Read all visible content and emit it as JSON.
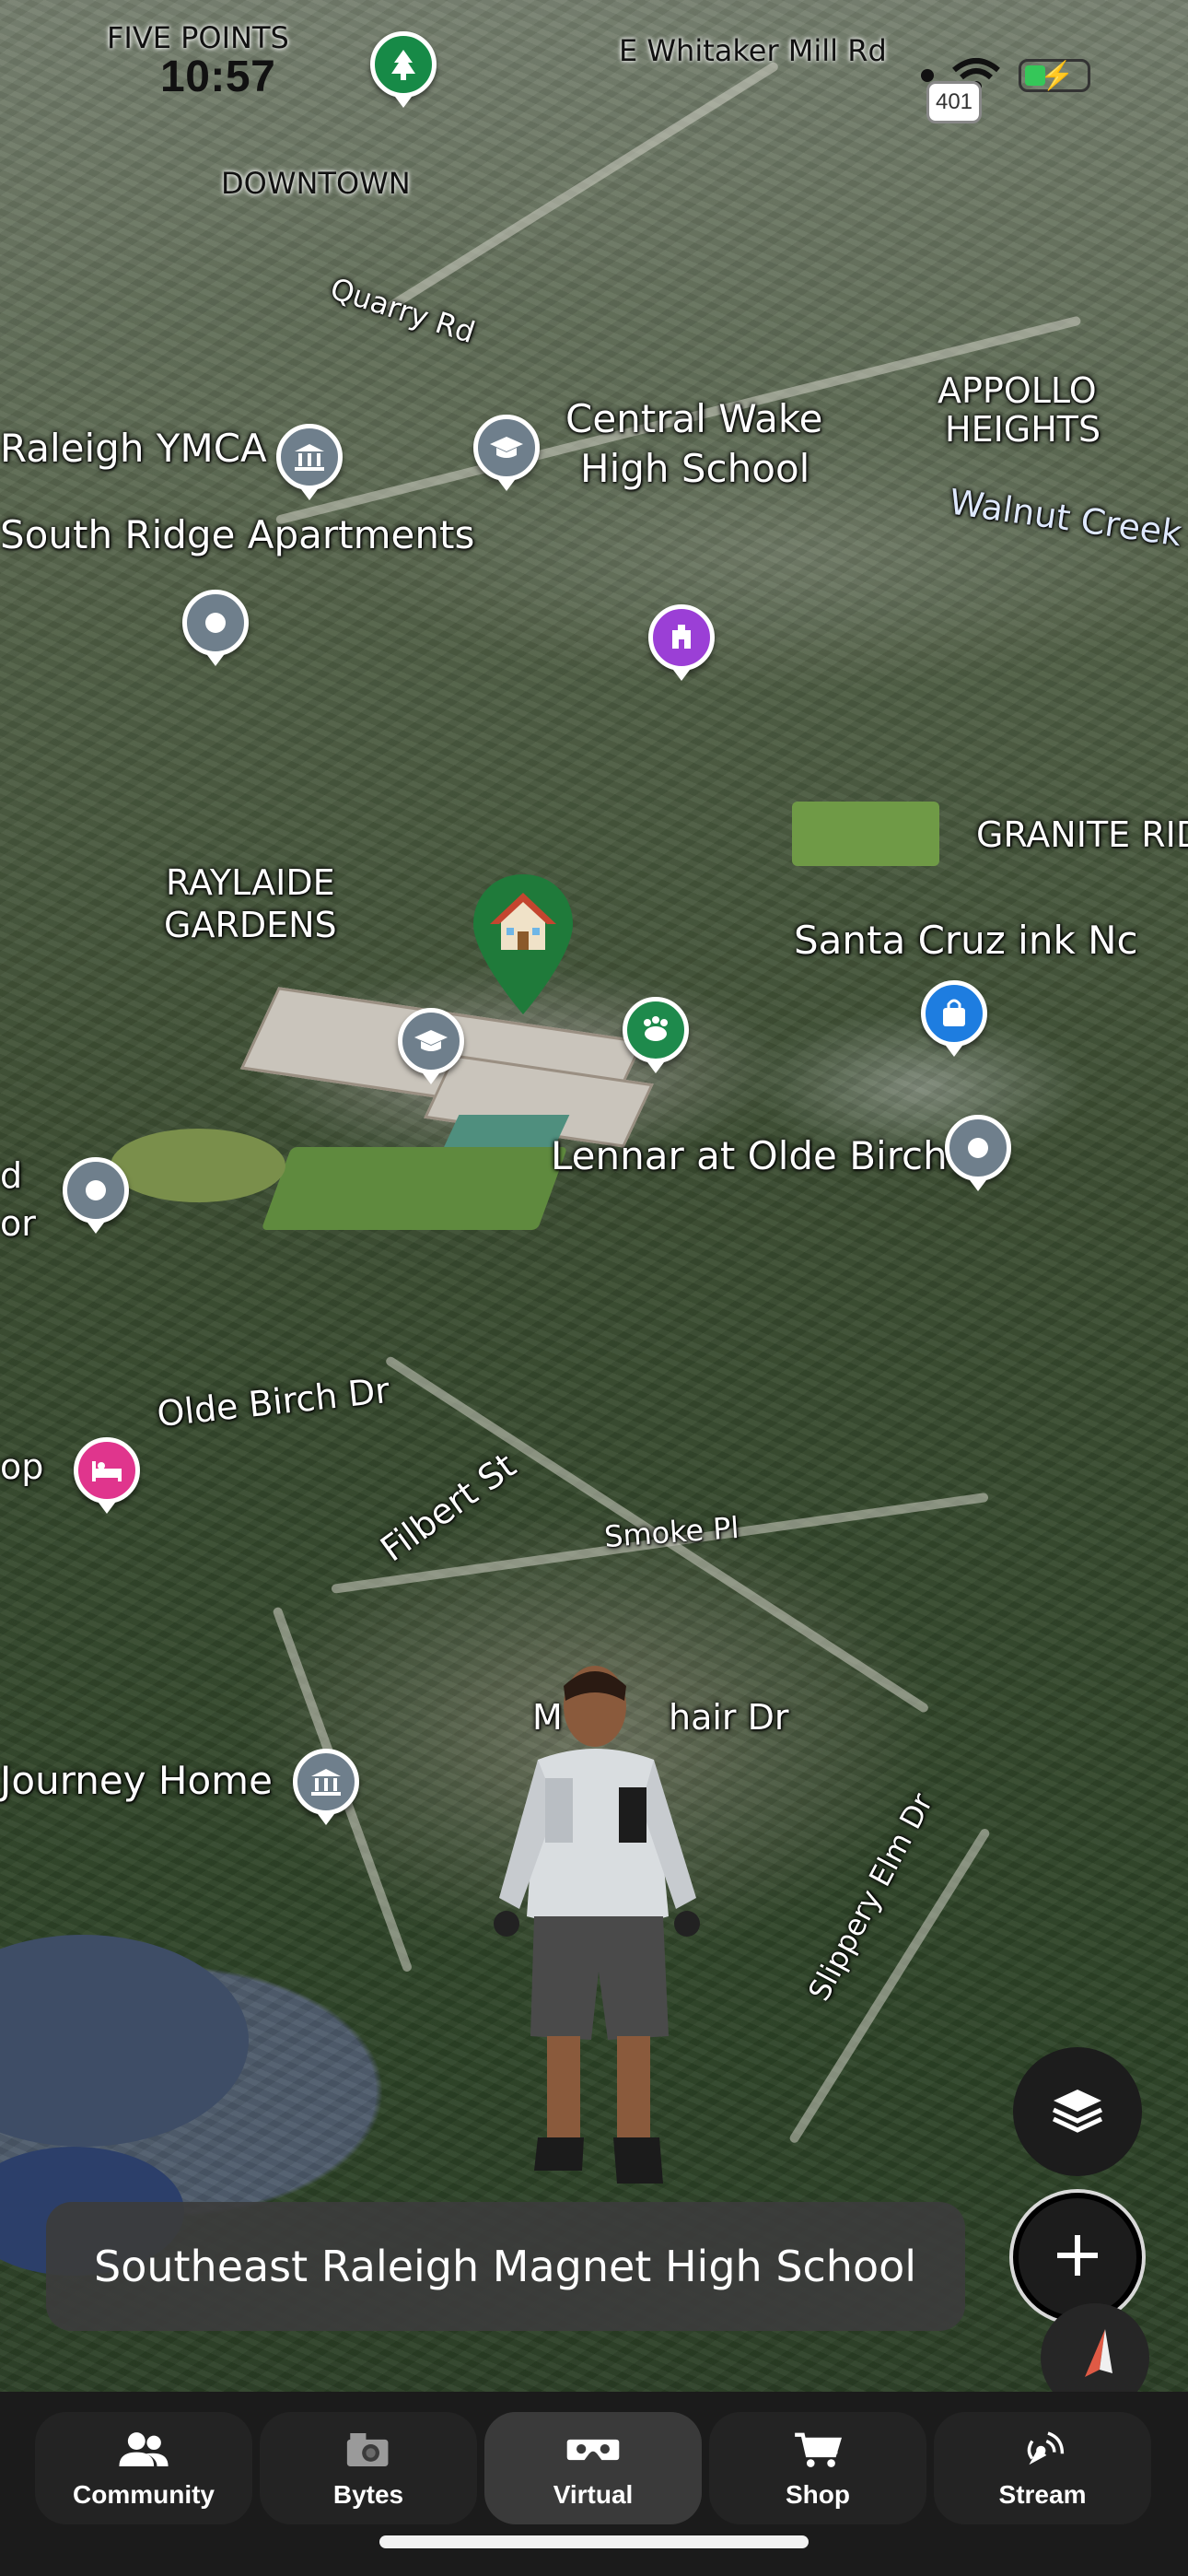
{
  "status_bar": {
    "time": "10:57",
    "location_hint": "FIVE POINTS",
    "route_badge": "401"
  },
  "map": {
    "labels": {
      "five_points": "FIVE POINTS",
      "whitaker": "E Whitaker Mill Rd",
      "downtown": "DOWNTOWN",
      "quarry": "Quarry Rd",
      "ymca": "Raleigh YMCA",
      "central_wake_1": "Central Wake",
      "central_wake_2": "High School",
      "apollo_1": "APPOLLO",
      "apollo_2": "HEIGHTS",
      "walnut_creek": "Walnut Creek",
      "south_ridge": "South Ridge Apartments",
      "granite": "GRANITE RID",
      "raylaide_1": "RAYLAIDE",
      "raylaide_2": "GARDENS",
      "santa_cruz": "Santa Cruz ink Nc",
      "lennar": "Lennar at Olde Birch",
      "left_d": "d",
      "left_or": "or",
      "olde_birch": "Olde Birch Dr",
      "op": "op",
      "filbert": "Filbert St",
      "smoke": "Smoke Pl",
      "mohair": "M",
      "mohair_2": "hair Dr",
      "journey_home": "Journey Home",
      "slippery_elm": "Slippery Elm Dr"
    },
    "pin_icons": {
      "tree": "tree-icon",
      "bank": "landmark-icon",
      "school": "school-icon",
      "place": "place-dot-icon",
      "attraction": "attraction-icon",
      "home": "home-icon",
      "pet": "pet-icon",
      "shopping": "shopping-bag-icon",
      "lodging": "bed-icon"
    }
  },
  "place_card": {
    "title": "Southeast Raleigh Magnet High School"
  },
  "controls": {
    "layers": "layers-icon",
    "add": "plus-icon",
    "compass": "compass-icon"
  },
  "tabs": [
    {
      "label": "Community",
      "icon": "community-icon"
    },
    {
      "label": "Bytes",
      "icon": "camera-icon"
    },
    {
      "label": "Virtual",
      "icon": "vr-headset-icon",
      "active": true
    },
    {
      "label": "Shop",
      "icon": "cart-icon"
    },
    {
      "label": "Stream",
      "icon": "stream-icon"
    }
  ],
  "colors": {
    "tab_bar": "#1b1b1b",
    "tab_active": "#3a3a3a",
    "home_pin": "#1f7a3a",
    "place_card_bg": "#3c3c3c"
  }
}
